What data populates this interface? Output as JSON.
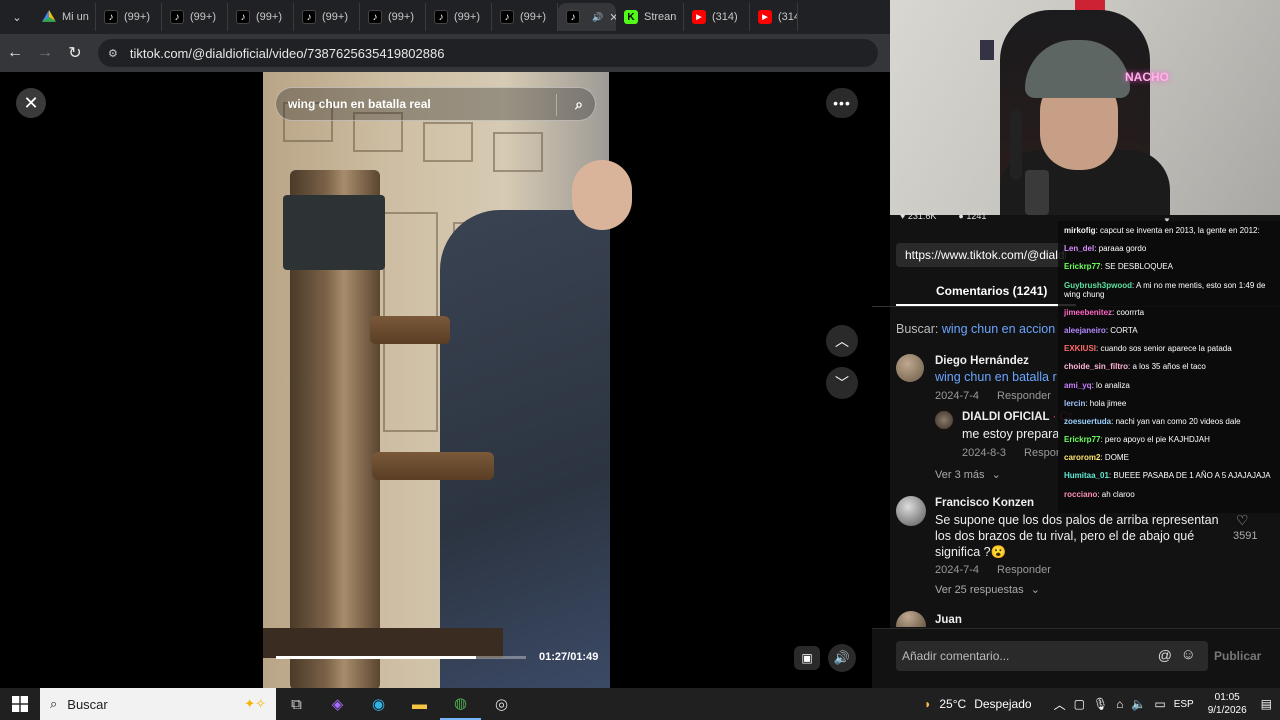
{
  "browser": {
    "tabs": [
      {
        "icon": "google-drive-icon",
        "label": "Mi un"
      },
      {
        "icon": "tiktok-icon",
        "label": "(99+)"
      },
      {
        "icon": "tiktok-icon",
        "label": "(99+)"
      },
      {
        "icon": "tiktok-icon",
        "label": "(99+)"
      },
      {
        "icon": "tiktok-icon",
        "label": "(99+)"
      },
      {
        "icon": "tiktok-icon",
        "label": "(99+)"
      },
      {
        "icon": "tiktok-icon",
        "label": "(99+)"
      },
      {
        "icon": "tiktok-icon",
        "label": "(99+)"
      },
      {
        "icon": "tiktok-icon",
        "label": "",
        "active": true
      },
      {
        "icon": "kick-icon",
        "label": "Strean"
      },
      {
        "icon": "youtube-icon",
        "label": "(314)"
      },
      {
        "icon": "youtube-icon",
        "label": "(314)"
      }
    ],
    "url": "tiktok.com/@dialdioficial/video/7387625635419802886"
  },
  "video": {
    "search_query": "wing chun en batalla real",
    "timecode": "01:27/01:49",
    "progress": 0.8
  },
  "stream_overlay": {
    "neon_sign": "NACHO",
    "likes": "231.6K",
    "comments_count": "1241"
  },
  "panel": {
    "share_url": "https://www.tiktok.com/@dialdi",
    "comments_tab": "Comentarios (1241)",
    "search_label": "Buscar:",
    "search_suggestion": "wing chun en accion",
    "comments": [
      {
        "author": "Diego Hernández",
        "text": "wing chun en batalla r",
        "date": "2024-7-4",
        "reply_label": "Responder",
        "reply": {
          "author": "DIALDI OFICIAL",
          "author_tag": "· Cr",
          "text": "me estoy prepara",
          "date": "2024-8-3",
          "reply_label": "Respor"
        },
        "more_label": "Ver 3 más"
      },
      {
        "author": "Francisco Konzen",
        "text": "Se supone que los dos palos de arriba representan los dos brazos de tu rival, pero el de abajo qué significa ?😮",
        "date": "2024-7-4",
        "reply_label": "Responder",
        "likes": "3591",
        "more_label": "Ver 25 respuestas"
      },
      {
        "author": "Juan"
      }
    ],
    "input_placeholder": "Añadir comentario...",
    "publish_label": "Publicar"
  },
  "chat": [
    {
      "user": "mirkofig",
      "color": "#f0f0f0",
      "msg": "capcut se inventa en 2013, la gente en 2012:"
    },
    {
      "user": "Len_del",
      "color": "#d88cff",
      "msg": "paraaa gordo"
    },
    {
      "user": "Erickrp77",
      "color": "#6dff5e",
      "msg": "SE DESBLOQUEA"
    },
    {
      "user": "Guybrush3pwood",
      "color": "#5ee0a0",
      "msg": "A mi no me mentis, esto son 1:49 de wing chung"
    },
    {
      "user": "jimeebenitez",
      "color": "#ff66c4",
      "msg": "coorrrta"
    },
    {
      "user": "aleejaneiro",
      "color": "#b388ff",
      "msg": "CORTA"
    },
    {
      "user": "EXKIUSI",
      "color": "#ff6b6b",
      "msg": "cuando sos senior aparece la patada"
    },
    {
      "user": "choide_sin_filtro",
      "color": "#ffb3d9",
      "msg": "a los 35 años el taco"
    },
    {
      "user": "ami_yq",
      "color": "#c77dff",
      "msg": "lo analiza"
    },
    {
      "user": "lercin",
      "color": "#a0c4ff",
      "msg": "hola jimee"
    },
    {
      "user": "zoesuertuda",
      "color": "#9ad0ff",
      "msg": "nachi yan van como 20 videos dale"
    },
    {
      "user": "Erickrp77",
      "color": "#6dff5e",
      "msg": "pero apoyo el pie KAJHDJAH"
    },
    {
      "user": "carorom2",
      "color": "#ffe66b",
      "msg": "DOME"
    },
    {
      "user": "Humitaa_01",
      "color": "#5eead4",
      "msg": "BUEEE PASABA DE 1 AÑO A 5 AJAJAJAJA"
    },
    {
      "user": "rocciano",
      "color": "#ff8fb3",
      "msg": "ah claroo"
    }
  ],
  "taskbar": {
    "search_label": "Buscar",
    "weather_temp": "25°C",
    "weather_text": "Despejado",
    "language": "ESP",
    "time": "01:05",
    "date": "9/1/2026"
  }
}
